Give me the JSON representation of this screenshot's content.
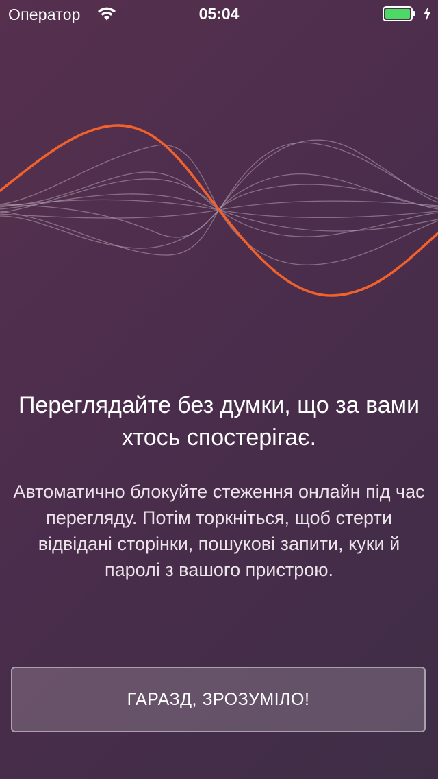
{
  "status_bar": {
    "carrier": "Оператор",
    "time": "05:04",
    "wifi_icon": "wifi-icon",
    "battery_icon": "battery-icon",
    "charging_icon": "charging-bolt-icon",
    "battery_color": "#4cd964"
  },
  "illustration": {
    "name": "sound-wave-illustration",
    "accent_color": "#f0612c",
    "line_color": "#b8a6b6"
  },
  "onboarding": {
    "headline": "Переглядайте без думки, що за вами хтось спостерігає.",
    "body": "Автоматично блокуйте стеження онлайн під час перегляду. Потім торкніться, щоб стерти відвідані сторінки, пошукові запити, куки й паролі з вашого пристрою.",
    "button_label": "ГАРАЗД, ЗРОЗУМІЛО!"
  },
  "theme": {
    "background_start": "#56304e",
    "background_end": "#3f2d46"
  }
}
